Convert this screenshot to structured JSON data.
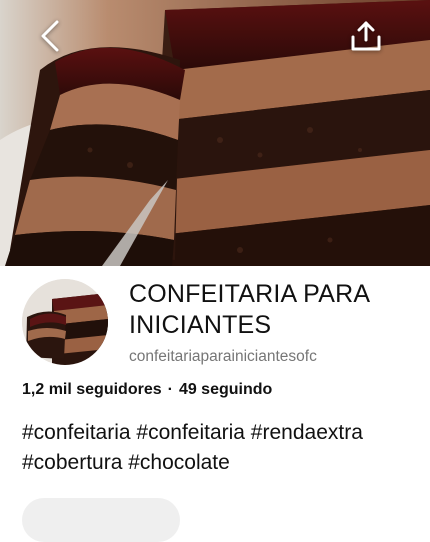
{
  "header": {
    "back_icon": "chevron-left-icon",
    "share_icon": "share-upload-icon",
    "cover_image": "chocolate-cake-slice"
  },
  "profile": {
    "avatar_image": "chocolate-cake-slice",
    "name": "CONFEITARIA PARA INICIANTES",
    "handle": "confeitariaparainiciantesofc",
    "followers": "1,2 mil seguidores",
    "separator": "·",
    "following": "49 seguindo",
    "bio": "#confeitaria #confeitaria #rendaextra #cobertura #chocolate"
  },
  "colors": {
    "text": "#111111",
    "muted": "#767676",
    "button_bg": "#efefef",
    "chocolate_dark": "#2b1610",
    "chocolate_cream": "#9c6547"
  }
}
